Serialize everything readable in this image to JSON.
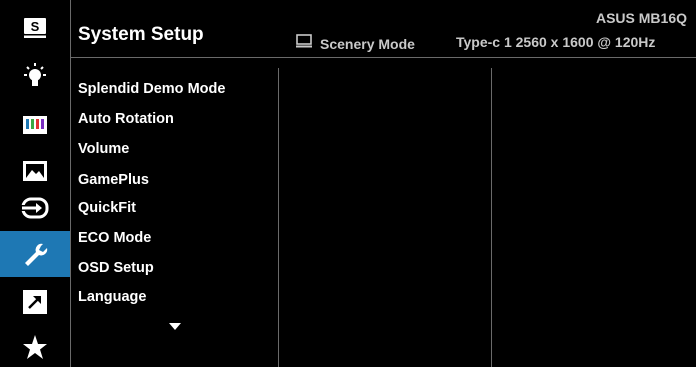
{
  "header": {
    "title": "System Setup",
    "model": "ASUS MB16Q",
    "mode_label": "Scenery Mode",
    "signal_label": "Type-c 1  2560 x 1600 @ 120Hz"
  },
  "sidebar": {
    "items": [
      {
        "name": "splendid",
        "icon": "splendid-s-icon"
      },
      {
        "name": "blue-light-filter",
        "icon": "light-bulb-icon"
      },
      {
        "name": "color",
        "icon": "color-bars-icon"
      },
      {
        "name": "image",
        "icon": "image-landscape-icon"
      },
      {
        "name": "input-select",
        "icon": "input-select-icon"
      },
      {
        "name": "system-setup",
        "icon": "wrench-icon",
        "active": true
      },
      {
        "name": "shortcut",
        "icon": "shortcut-arrow-icon"
      },
      {
        "name": "myfavorite",
        "icon": "star-icon"
      }
    ]
  },
  "menu": {
    "items": [
      "Splendid Demo Mode",
      "Auto Rotation",
      "Volume",
      "GamePlus",
      "QuickFit",
      "ECO Mode",
      "OSD Setup",
      "Language"
    ],
    "more_indicator": "down-triangle-icon"
  },
  "colors": {
    "background": "#000000",
    "active": "#1e78b4",
    "text": "#ffffff",
    "secondary_text": "#c9c9c9",
    "divider": "#6a6a6a"
  }
}
